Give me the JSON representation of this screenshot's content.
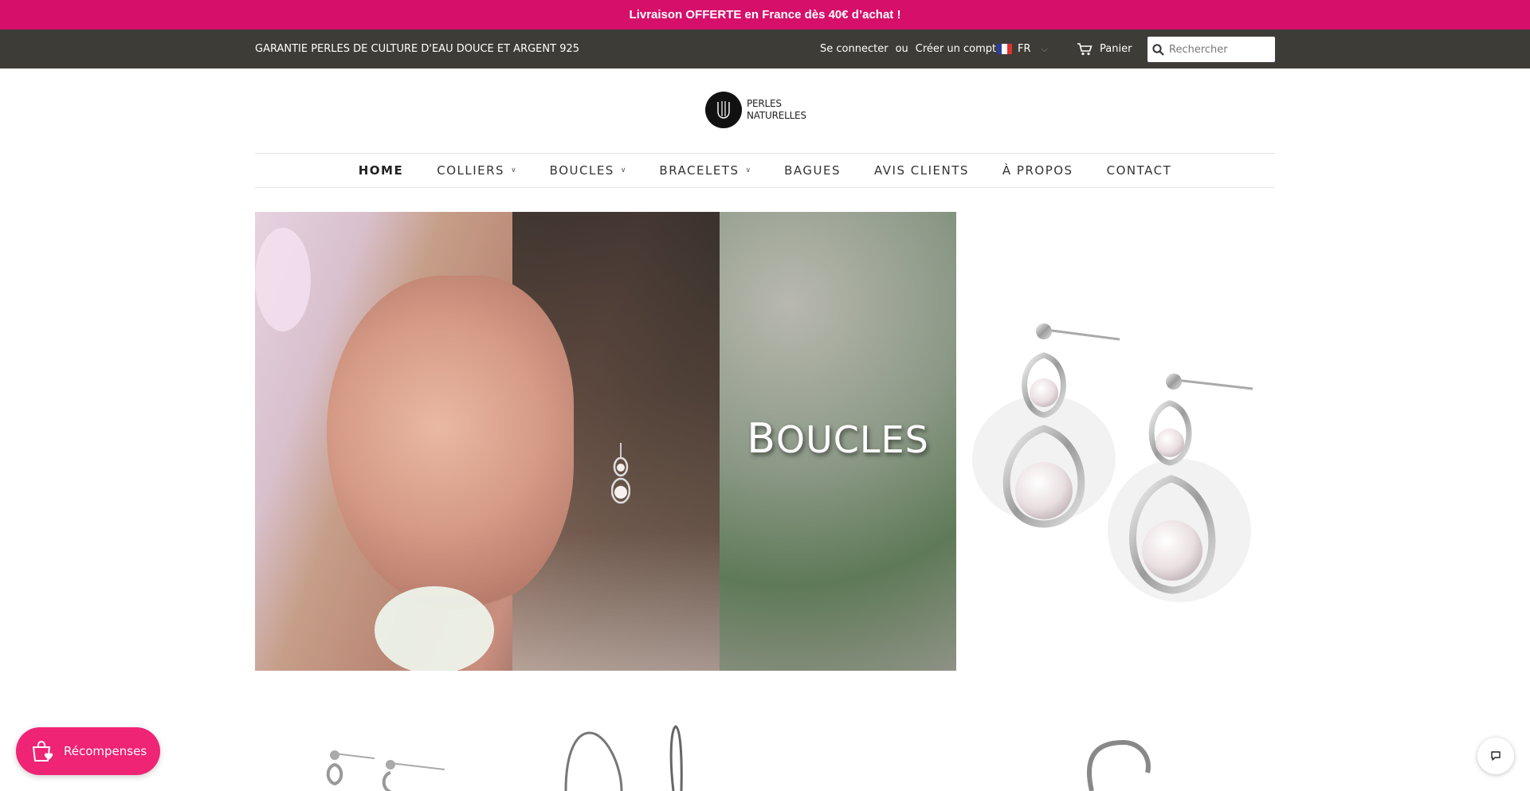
{
  "announcement": {
    "text": "Livraison OFFERTE en France dès 40€ d’achat !"
  },
  "topbar": {
    "tagline": "GARANTIE PERLES DE CULTURE D'EAU DOUCE ET ARGENT 925",
    "login": "Se connecter",
    "or": "ou",
    "register": "Créer un compte",
    "language": "FR",
    "cart": "Panier",
    "search_placeholder": "Rechercher"
  },
  "logo": {
    "line1": "PERLES",
    "line2": "NATURELLES"
  },
  "nav": {
    "items": [
      {
        "label": "HOME",
        "active": true
      },
      {
        "label": "COLLIERS",
        "dropdown": true
      },
      {
        "label": "BOUCLES",
        "dropdown": true
      },
      {
        "label": "BRACELETS",
        "dropdown": true
      },
      {
        "label": "BAGUES"
      },
      {
        "label": "AVIS CLIENTS"
      },
      {
        "label": "À PROPOS"
      },
      {
        "label": "CONTACT"
      }
    ]
  },
  "hero": {
    "title_first": "B",
    "title_rest": "OUCLES"
  },
  "rewards": {
    "label": "Récompenses"
  },
  "colors": {
    "announcement_bg": "#d60f6a",
    "topbar_bg": "#3e3c37",
    "rewards_bg": "#ef2474"
  }
}
